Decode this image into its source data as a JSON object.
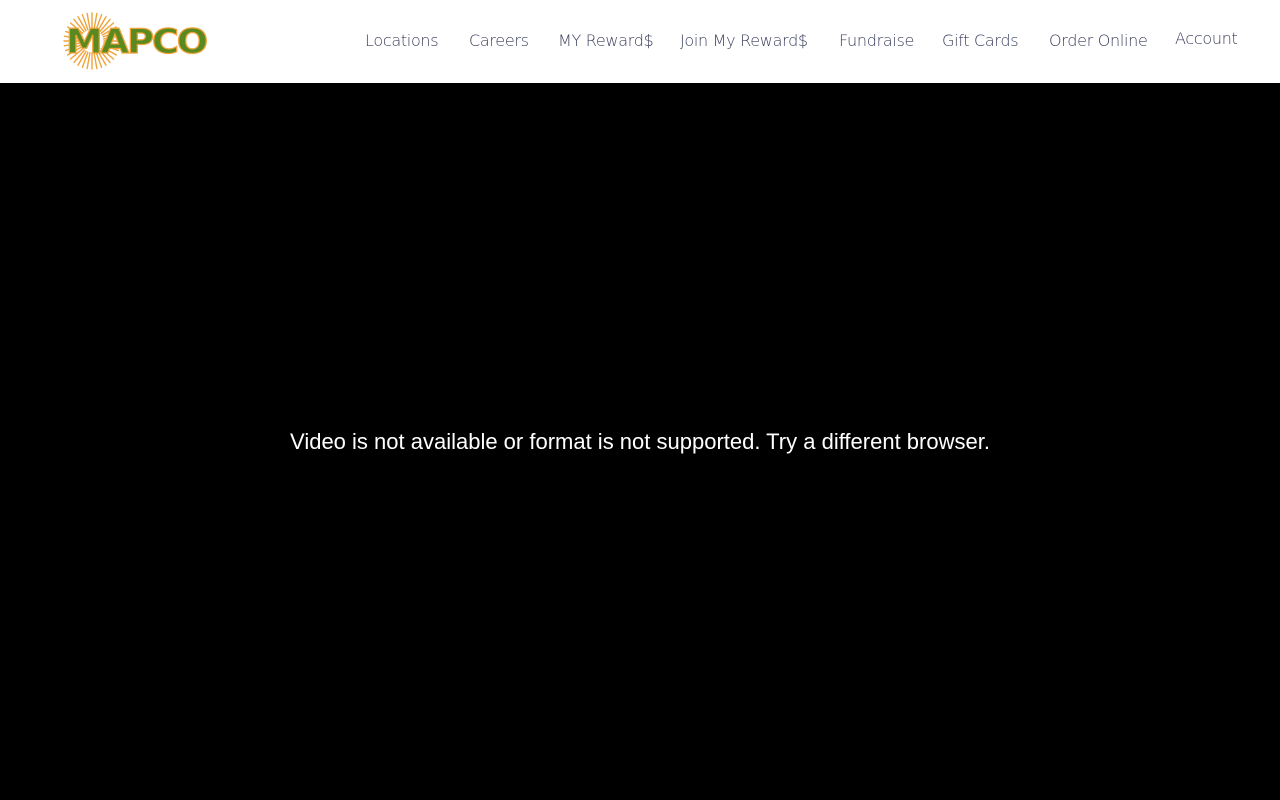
{
  "brand": {
    "name": "MAPCO",
    "colors": {
      "green": "#5a8a1f",
      "orange": "#f0a33a",
      "nav_text": "#3b3f5c"
    }
  },
  "nav": {
    "items": [
      {
        "label": "Locations"
      },
      {
        "label": "Careers"
      },
      {
        "label": "MY Reward$"
      },
      {
        "label": "Join My Reward$"
      },
      {
        "label": "Fundraise"
      },
      {
        "label": "Gift Cards"
      },
      {
        "label": "Order Online"
      },
      {
        "label": "Account"
      }
    ]
  },
  "video": {
    "message": "Video is not available or format is not supported. Try a different browser."
  }
}
